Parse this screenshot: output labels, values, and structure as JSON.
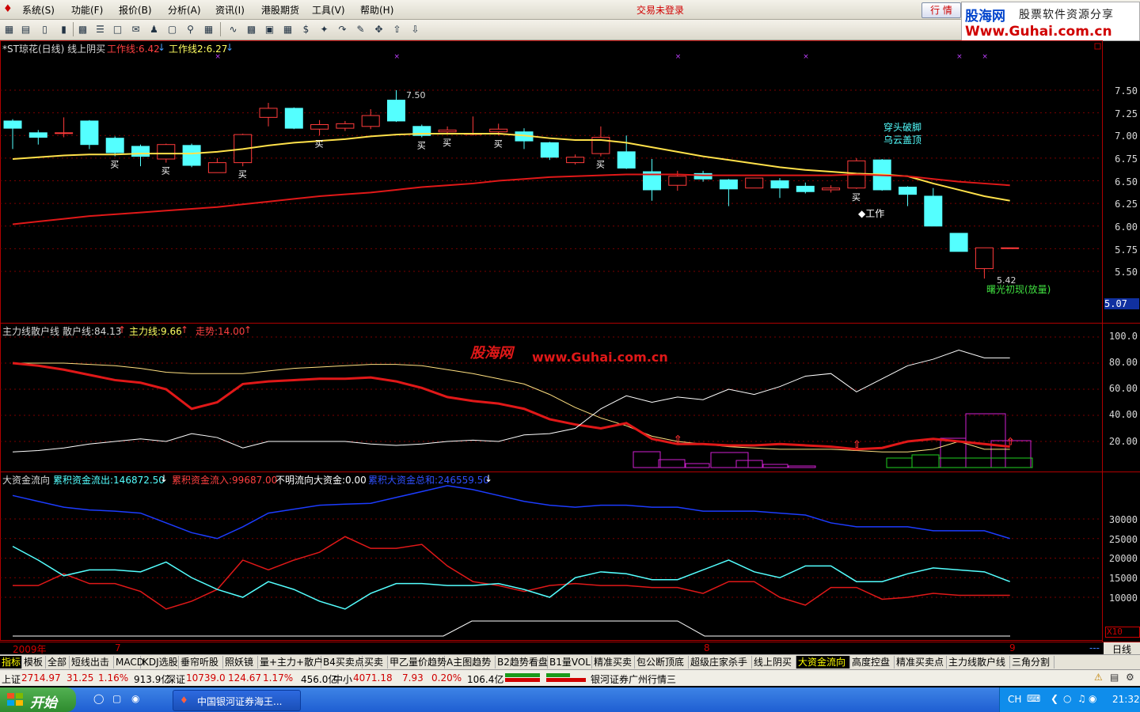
{
  "menu": {
    "items": [
      "系统(S)",
      "功能(F)",
      "报价(B)",
      "分析(A)",
      "资讯(I)",
      "港股期货",
      "工具(V)",
      "帮助(H)"
    ],
    "trade_status": "交易未登录",
    "quote_button": "行 情"
  },
  "brand": {
    "name": "股海网",
    "tagline": "股票软件资源分享",
    "url": "Www.Guhai.com.cn"
  },
  "colors": {
    "background": "#000000",
    "up": "#ff3b3b",
    "down": "#54ffff",
    "ma_short": "#ffe14a",
    "ma_long": "#e01818",
    "blue_line": "#1c3cff"
  },
  "main_panel": {
    "title": "*ST琼花(日线) 线上阴买",
    "work1": "工作线:6.42",
    "work2": "工作线2:6.27",
    "y_ticks": [
      "7.50",
      "7.25",
      "7.00",
      "6.75",
      "6.50",
      "6.25",
      "6.00",
      "5.75",
      "5.50"
    ],
    "current_price": "5.07",
    "max_label": "7.50",
    "min_label": "5.42",
    "annot_1": "穿头破脚",
    "annot_2": "乌云盖顶",
    "annot_work": "◆工作",
    "annot_dawn": "曙光初现(放量)",
    "buy_label": "买"
  },
  "indicator_panel": {
    "name": "主力线散户线",
    "retail": "散户线:84.13",
    "main_force": "主力线:9.66",
    "trend": "走势:14.00",
    "watermark_1": "股海网",
    "watermark_2": "www.Guhai.com.cn",
    "y_ticks": [
      "100.0",
      "80.00",
      "60.00",
      "40.00",
      "20.00"
    ]
  },
  "flow_panel": {
    "name": "大资金流向",
    "outflow": "累积资金流出:146872.50",
    "inflow": "累积资金流入:99687.00",
    "unknown": "不明流向大资金:0.00",
    "total": "累积大资金总和:246559.50",
    "y_ticks": [
      "30000",
      "25000",
      "20000",
      "15000",
      "10000"
    ],
    "x_mult": "X10"
  },
  "dates": [
    "2009年",
    "7",
    "8",
    "9"
  ],
  "period": "日线",
  "tabs": [
    "指标",
    "模板",
    "全部",
    "短线出击",
    "MACD",
    "KDJ选股",
    "垂帘听股",
    "照妖镜",
    "量+主力+散户",
    "B4买卖点",
    "买卖",
    "甲乙量价趋势",
    "A主图趋势",
    "B2趋势看盘",
    "B1量VOL",
    "精准买卖",
    "包公断顶底",
    "超级庄家杀手",
    "线上阴买",
    "大资金流向",
    "高度控盘",
    "精准买卖点",
    "主力线散户线",
    "三角分割"
  ],
  "status_bar": {
    "sh_label": "上证",
    "sh_value": "2714.97",
    "sh_change": "31.25",
    "sh_pct": "1.16%",
    "sh_amount": "913.9亿",
    "sz_label": "深证",
    "sz_value": "10739.0",
    "sz_change": "124.67",
    "sz_pct": "1.17%",
    "sz_amount": "456.0亿",
    "zx_label": "中小",
    "zx_value": "4071.18",
    "zx_change": "7.93",
    "zx_pct": "0.20%",
    "zx_amount": "106.4亿",
    "broker": "银河证券广州行情三"
  },
  "taskbar": {
    "start": "开始",
    "task": "中国银河证券海王...",
    "lang": "CH",
    "time": "21:32"
  },
  "chart_data": [
    {
      "type": "candlestick",
      "title": "*ST琼花(日线) 线上阴买",
      "ylim": [
        5.07,
        7.6
      ],
      "candles": [
        {
          "o": 7.08,
          "c": 7.16,
          "h": 7.18,
          "l": 6.85,
          "up": false
        },
        {
          "o": 6.98,
          "c": 7.03,
          "h": 7.06,
          "l": 6.9,
          "up": false
        },
        {
          "o": 7.03,
          "c": 7.03,
          "h": 7.2,
          "l": 6.98,
          "up": true
        },
        {
          "o": 7.16,
          "c": 6.9,
          "h": 7.17,
          "l": 6.85,
          "up": false
        },
        {
          "o": 6.97,
          "c": 6.81,
          "h": 6.99,
          "l": 6.77,
          "up": false
        },
        {
          "o": 6.88,
          "c": 6.77,
          "h": 6.9,
          "l": 6.66,
          "up": false
        },
        {
          "o": 6.74,
          "c": 6.9,
          "h": 6.91,
          "l": 6.7,
          "up": true
        },
        {
          "o": 6.89,
          "c": 6.67,
          "h": 6.91,
          "l": 6.65,
          "up": false
        },
        {
          "o": 6.59,
          "c": 6.7,
          "h": 6.75,
          "l": 6.59,
          "up": true
        },
        {
          "o": 6.7,
          "c": 7.01,
          "h": 7.02,
          "l": 6.66,
          "up": true
        },
        {
          "o": 7.2,
          "c": 7.3,
          "h": 7.36,
          "l": 7.1,
          "up": true
        },
        {
          "o": 7.3,
          "c": 7.08,
          "h": 7.31,
          "l": 7.07,
          "up": false
        },
        {
          "o": 7.07,
          "c": 7.12,
          "h": 7.17,
          "l": 7.0,
          "up": true
        },
        {
          "o": 7.08,
          "c": 7.13,
          "h": 7.16,
          "l": 7.05,
          "up": true
        },
        {
          "o": 7.1,
          "c": 7.22,
          "h": 7.29,
          "l": 7.07,
          "up": true
        },
        {
          "o": 7.39,
          "c": 7.16,
          "h": 7.5,
          "l": 7.15,
          "up": false
        },
        {
          "o": 7.1,
          "c": 7.0,
          "h": 7.12,
          "l": 6.98,
          "up": false
        },
        {
          "o": 7.04,
          "c": 7.06,
          "h": 7.1,
          "l": 7.01,
          "up": true
        },
        {
          "o": 7.02,
          "c": 7.02,
          "h": 7.21,
          "l": 7.0,
          "up": true
        },
        {
          "o": 7.07,
          "c": 7.04,
          "h": 7.13,
          "l": 7.0,
          "up": true
        },
        {
          "o": 7.04,
          "c": 6.94,
          "h": 7.08,
          "l": 6.85,
          "up": false
        },
        {
          "o": 6.92,
          "c": 6.76,
          "h": 6.93,
          "l": 6.73,
          "up": false
        },
        {
          "o": 6.7,
          "c": 6.76,
          "h": 6.79,
          "l": 6.68,
          "up": true
        },
        {
          "o": 6.8,
          "c": 6.98,
          "h": 7.1,
          "l": 6.77,
          "up": true
        },
        {
          "o": 6.82,
          "c": 6.64,
          "h": 7.0,
          "l": 6.63,
          "up": false
        },
        {
          "o": 6.6,
          "c": 6.4,
          "h": 6.74,
          "l": 6.28,
          "up": false
        },
        {
          "o": 6.45,
          "c": 6.55,
          "h": 6.61,
          "l": 6.39,
          "up": true
        },
        {
          "o": 6.58,
          "c": 6.52,
          "h": 6.61,
          "l": 6.49,
          "up": false
        },
        {
          "o": 6.51,
          "c": 6.41,
          "h": 6.52,
          "l": 6.22,
          "up": false
        },
        {
          "o": 6.42,
          "c": 6.53,
          "h": 6.53,
          "l": 6.42,
          "up": true
        },
        {
          "o": 6.5,
          "c": 6.42,
          "h": 6.53,
          "l": 6.31,
          "up": false
        },
        {
          "o": 6.44,
          "c": 6.38,
          "h": 6.48,
          "l": 6.36,
          "up": false
        },
        {
          "o": 6.4,
          "c": 6.42,
          "h": 6.45,
          "l": 6.37,
          "up": true
        },
        {
          "o": 6.42,
          "c": 6.72,
          "h": 6.75,
          "l": 6.41,
          "up": true
        },
        {
          "o": 6.73,
          "c": 6.4,
          "h": 6.74,
          "l": 6.39,
          "up": false
        },
        {
          "o": 6.43,
          "c": 6.35,
          "h": 6.44,
          "l": 6.22,
          "up": false
        },
        {
          "o": 6.33,
          "c": 6.0,
          "h": 6.42,
          "l": 6.0,
          "up": false
        },
        {
          "o": 5.92,
          "c": 5.72,
          "h": 5.92,
          "l": 5.72,
          "up": false
        },
        {
          "o": 5.53,
          "c": 5.76,
          "h": 5.76,
          "l": 5.42,
          "up": true
        },
        {
          "o": 5.76,
          "c": 5.76,
          "h": 5.76,
          "l": 5.76,
          "up": true
        }
      ],
      "ma_short": [
        6.74,
        6.76,
        6.78,
        6.79,
        6.79,
        6.8,
        6.8,
        6.8,
        6.82,
        6.85,
        6.89,
        6.92,
        6.94,
        6.96,
        6.99,
        7.01,
        7.02,
        7.02,
        7.02,
        7.02,
        7.0,
        6.97,
        6.95,
        6.95,
        6.92,
        6.87,
        6.82,
        6.77,
        6.73,
        6.69,
        6.65,
        6.62,
        6.6,
        6.58,
        6.57,
        6.55,
        6.47,
        6.4,
        6.33,
        6.28
      ],
      "ma_long": [
        6.02,
        6.05,
        6.08,
        6.11,
        6.13,
        6.15,
        6.17,
        6.19,
        6.21,
        6.24,
        6.27,
        6.3,
        6.33,
        6.35,
        6.37,
        6.4,
        6.43,
        6.45,
        6.47,
        6.5,
        6.52,
        6.54,
        6.55,
        6.56,
        6.57,
        6.57,
        6.57,
        6.56,
        6.56,
        6.56,
        6.56,
        6.56,
        6.56,
        6.57,
        6.56,
        6.55,
        6.52,
        6.49,
        6.47,
        6.45
      ],
      "buy_marks": [
        4,
        6,
        9,
        12,
        16,
        17,
        19,
        23,
        33
      ],
      "top_marks": [
        8,
        15,
        26,
        31,
        37,
        38
      ]
    },
    {
      "type": "line",
      "name": "主力线散户线",
      "ylim": [
        0,
        105
      ],
      "series": [
        {
          "name": "散户线",
          "values": [
            80,
            80,
            80,
            79,
            78,
            76,
            73,
            72,
            72,
            72,
            74,
            76,
            77,
            78,
            79,
            79,
            78,
            75,
            72,
            68,
            64,
            56,
            46,
            38,
            32,
            24,
            20,
            18,
            16,
            15,
            14,
            14,
            14,
            13,
            12,
            12,
            14,
            20,
            14,
            14
          ]
        },
        {
          "name": "主力线",
          "values": [
            80,
            78,
            75,
            71,
            67,
            65,
            60,
            45,
            50,
            64,
            66,
            67,
            68,
            68,
            69,
            66,
            61,
            54,
            51,
            49,
            45,
            37,
            33,
            30,
            34,
            22,
            18,
            18,
            17,
            17,
            18,
            17,
            16,
            14,
            15,
            20,
            22,
            20,
            18,
            16
          ]
        },
        {
          "values": [
            12,
            13,
            15,
            18,
            20,
            22,
            20,
            26,
            23,
            15,
            20,
            20,
            20,
            20,
            18,
            17,
            18,
            20,
            21,
            20,
            25,
            26,
            30,
            45,
            55,
            50,
            54,
            52,
            60,
            56,
            62,
            70,
            72,
            58,
            68,
            78,
            83,
            90,
            84,
            84
          ]
        }
      ]
    },
    {
      "type": "line",
      "name": "大资金流向",
      "ylim": [
        5000,
        38000
      ],
      "series": [
        {
          "name": "累积资金流出",
          "values": [
            36000,
            34500,
            33000,
            32300,
            32000,
            31500,
            29000,
            26500,
            25000,
            28000,
            31500,
            32500,
            33500,
            33800,
            34000,
            35500,
            37000,
            38500,
            37500,
            36000,
            34500,
            33500,
            33000,
            33500,
            33500,
            33000,
            33000,
            32000,
            32000,
            32000,
            31500,
            31000,
            29000,
            28000,
            28000,
            28000,
            27000,
            27000,
            27000,
            25000
          ]
        },
        {
          "name": "累积资金流入",
          "values": [
            13000,
            13000,
            16000,
            13500,
            13500,
            11500,
            7000,
            9000,
            12000,
            19500,
            17000,
            19500,
            21500,
            25500,
            22500,
            22500,
            23500,
            18000,
            14000,
            13000,
            11500,
            13000,
            13500,
            13000,
            13000,
            12500,
            12500,
            11000,
            14000,
            14000,
            10000,
            8000,
            12500,
            12500,
            9500,
            10000,
            11000,
            10500,
            10500,
            10500
          ]
        },
        {
          "values": [
            23000,
            19500,
            15500,
            17000,
            17000,
            16500,
            19000,
            15000,
            12000,
            10000,
            14000,
            12000,
            9000,
            7000,
            11000,
            13500,
            13500,
            13000,
            13000,
            13500,
            12000,
            10000,
            15000,
            16500,
            16000,
            14500,
            14500,
            17000,
            19500,
            16500,
            15000,
            18000,
            18000,
            14000,
            14000,
            16000,
            17500,
            17000,
            16500,
            14000
          ]
        }
      ]
    }
  ]
}
